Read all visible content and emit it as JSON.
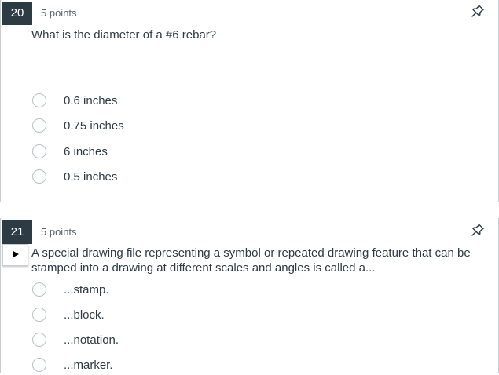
{
  "questions": [
    {
      "number": "20",
      "points": "5 points",
      "text": "What is the diameter of a #6 rebar?",
      "answers": [
        "0.6 inches",
        "0.75 inches",
        "6 inches",
        "0.5 inches"
      ]
    },
    {
      "number": "21",
      "points": "5 points",
      "text": "A special drawing file representing a symbol or repeated drawing feature that can be stamped into a drawing at different scales and angles is called a...",
      "answers": [
        "...stamp.",
        "...block.",
        "...notation.",
        "...marker."
      ]
    }
  ],
  "icons": {
    "pin": "pin-icon",
    "play": "play-icon",
    "radio": "radio-button"
  },
  "colors": {
    "number_badge_bg": "#2d3b45",
    "text": "#2d3b45",
    "radio_border": "#b9c0c6"
  }
}
